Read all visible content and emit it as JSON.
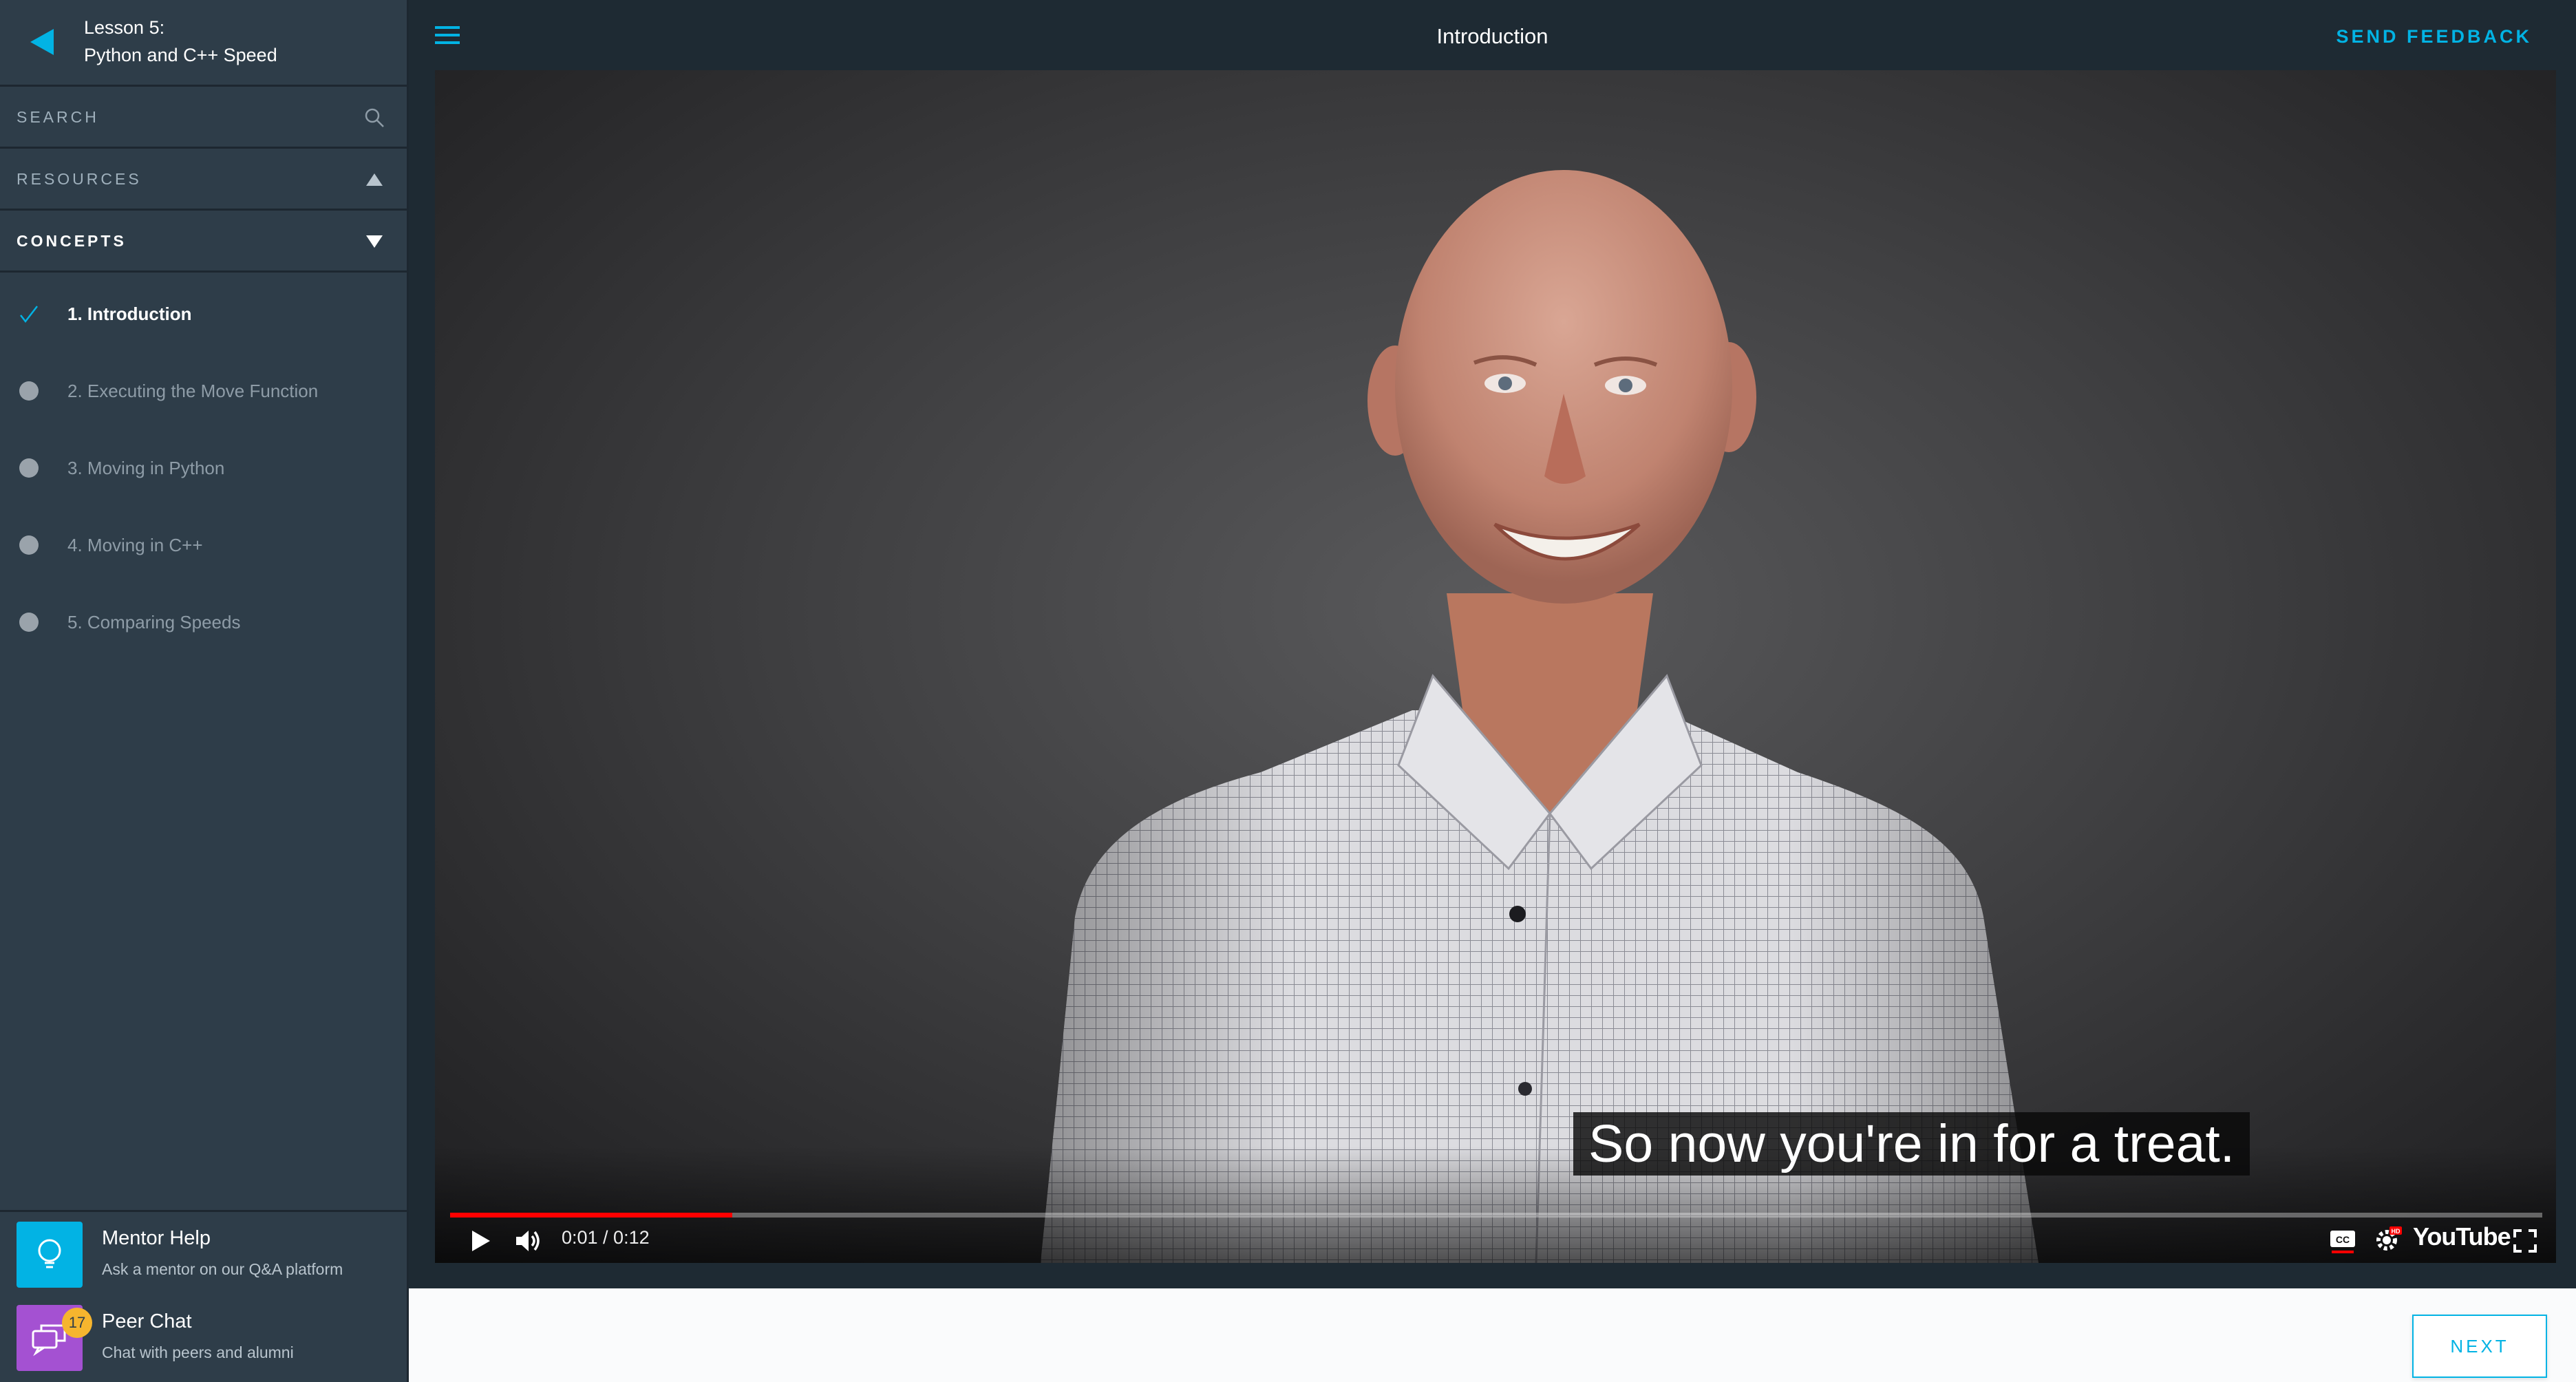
{
  "sidebar": {
    "lesson_line1": "Lesson 5:",
    "lesson_line2": "Python and C++ Speed",
    "search_label": "SEARCH",
    "resources_label": "RESOURCES",
    "concepts_label": "CONCEPTS",
    "concepts": [
      {
        "label": "1. Introduction",
        "status": "completed"
      },
      {
        "label": "2. Executing the Move Function",
        "status": "incomplete"
      },
      {
        "label": "3. Moving in Python",
        "status": "incomplete"
      },
      {
        "label": "4. Moving in C++",
        "status": "incomplete"
      },
      {
        "label": "5. Comparing Speeds",
        "status": "incomplete"
      }
    ],
    "mentor": {
      "title": "Mentor Help",
      "subtitle": "Ask a mentor on our Q&A platform",
      "icon": "lightbulb-icon"
    },
    "peer": {
      "title": "Peer Chat",
      "subtitle": "Chat with peers and alumni",
      "badge": "17",
      "icon": "chat-bubbles-icon"
    }
  },
  "header": {
    "title": "Introduction",
    "feedback_label": "SEND FEEDBACK"
  },
  "video": {
    "subtitle": "So now you're in for a treat.",
    "time": "0:01 / 0:12",
    "progress_fraction": 0.135,
    "logo_text": "YouTube"
  },
  "footer": {
    "next_label": "NEXT"
  },
  "colors": {
    "accent": "#02b3e4",
    "sidebar_bg": "#2e3d49",
    "topbar_bg": "#1e2a33",
    "peer_chat": "#a451d2",
    "badge": "#f6b52e",
    "progress": "#ff0000"
  }
}
